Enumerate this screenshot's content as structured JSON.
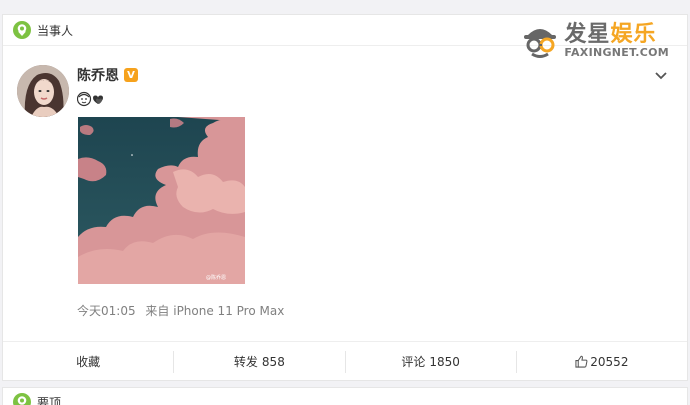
{
  "section": {
    "title": "当事人"
  },
  "watermark": {
    "main_dark": "发星",
    "main_accent": "娱乐",
    "sub": "FAXINGNET.COM"
  },
  "post": {
    "username": "陈乔恩",
    "verified_badge": "V",
    "timestamp": "今天01:05",
    "source": "来自 iPhone 11 Pro Max",
    "image_watermark": "@陈乔恩"
  },
  "actions": {
    "favorite_label": "收藏",
    "repost_label": "转发",
    "repost_count": "858",
    "comment_label": "评论",
    "comment_count": "1850",
    "like_count": "20552"
  },
  "next_section": {
    "title": "要顶"
  },
  "colors": {
    "accent_green": "#7dc242",
    "badge_orange": "#f6a21d",
    "watermark_orange": "#f5a623"
  },
  "icons": [
    "location-pin-icon",
    "chevron-down-icon",
    "verified-v-icon",
    "thumbs-up-icon",
    "detective-logo-icon"
  ]
}
